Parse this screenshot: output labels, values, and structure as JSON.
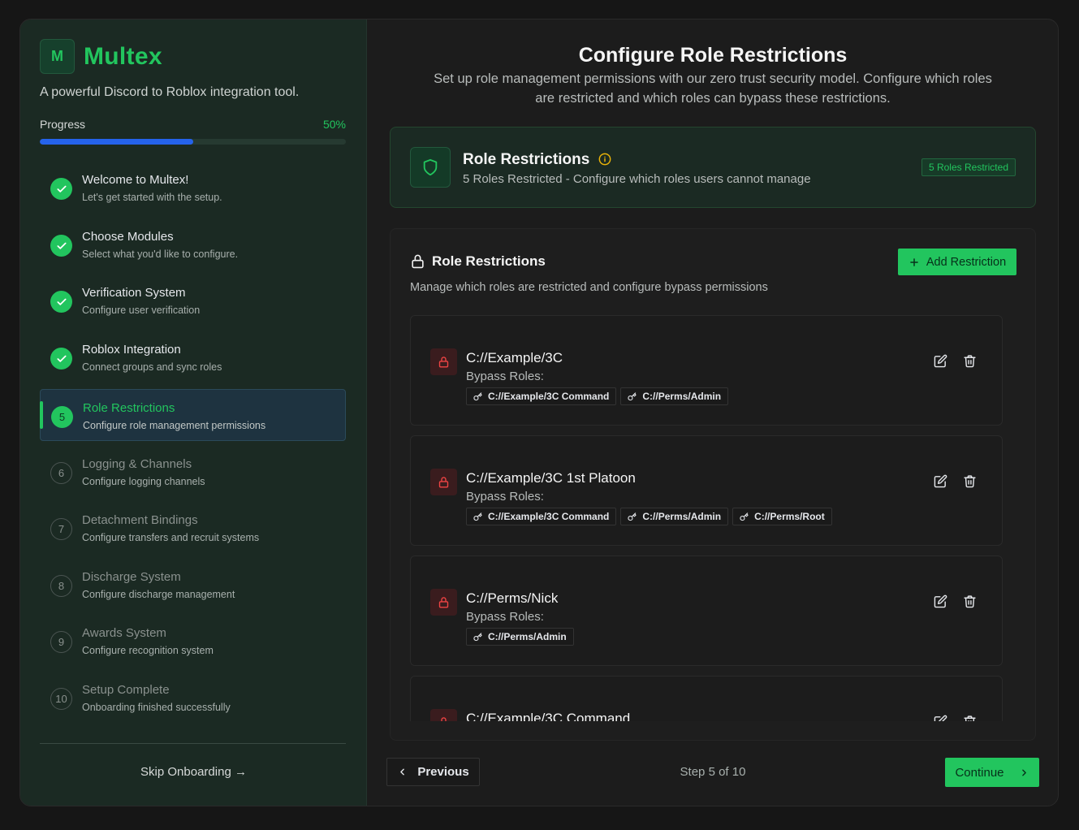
{
  "sidebar": {
    "logo_letter": "M",
    "brand": "Multex",
    "tagline": "A powerful Discord to Roblox integration tool.",
    "progress_label": "Progress",
    "progress_text": "50%",
    "progress_value": 0.5,
    "steps": [
      {
        "number": "1",
        "title": "Welcome to Multex!",
        "subtitle": "Let's get started with the setup.",
        "state": "done"
      },
      {
        "number": "2",
        "title": "Choose Modules",
        "subtitle": "Select what you'd like to configure.",
        "state": "done"
      },
      {
        "number": "3",
        "title": "Verification System",
        "subtitle": "Configure user verification",
        "state": "done"
      },
      {
        "number": "4",
        "title": "Roblox Integration",
        "subtitle": "Connect groups and sync roles",
        "state": "done"
      },
      {
        "number": "5",
        "title": "Role Restrictions",
        "subtitle": "Configure role management permissions",
        "state": "active"
      },
      {
        "number": "6",
        "title": "Logging & Channels",
        "subtitle": "Configure logging channels",
        "state": "pending"
      },
      {
        "number": "7",
        "title": "Detachment Bindings",
        "subtitle": "Configure transfers and recruit systems",
        "state": "pending"
      },
      {
        "number": "8",
        "title": "Discharge System",
        "subtitle": "Configure discharge management",
        "state": "pending"
      },
      {
        "number": "9",
        "title": "Awards System",
        "subtitle": "Configure recognition system",
        "state": "pending"
      },
      {
        "number": "10",
        "title": "Setup Complete",
        "subtitle": "Onboarding finished successfully",
        "state": "pending"
      }
    ],
    "skip_label": "Skip Onboarding →"
  },
  "main": {
    "title": "Configure Role Restrictions",
    "description": "Set up role management permissions with our zero trust security model. Configure which roles are restricted and which roles can bypass these restrictions.",
    "summary": {
      "title": "Role Restrictions",
      "subtitle": "5 Roles Restricted - Configure which roles users cannot manage",
      "badge": "5 Roles Restricted"
    },
    "panel": {
      "title": "Role Restrictions",
      "subtitle": "Manage which roles are restricted and configure bypass permissions",
      "add_label": "Add Restriction",
      "bypass_label": "Bypass Roles:",
      "restrictions": [
        {
          "name": "C://Example/3C",
          "bypass": [
            "C://Example/3C Command",
            "C://Perms/Admin"
          ]
        },
        {
          "name": "C://Example/3C 1st Platoon",
          "bypass": [
            "C://Example/3C Command",
            "C://Perms/Admin",
            "C://Perms/Root"
          ]
        },
        {
          "name": "C://Perms/Nick",
          "bypass": [
            "C://Perms/Admin"
          ]
        },
        {
          "name": "C://Example/3C Command",
          "bypass": []
        }
      ]
    },
    "footer": {
      "previous_label": "Previous",
      "step_text": "Step 5 of 10",
      "continue_label": "Continue"
    }
  },
  "colors": {
    "accent": "#22c55e",
    "progress": "#2563eb",
    "danger": "#ef4444",
    "warning": "#eab308"
  }
}
